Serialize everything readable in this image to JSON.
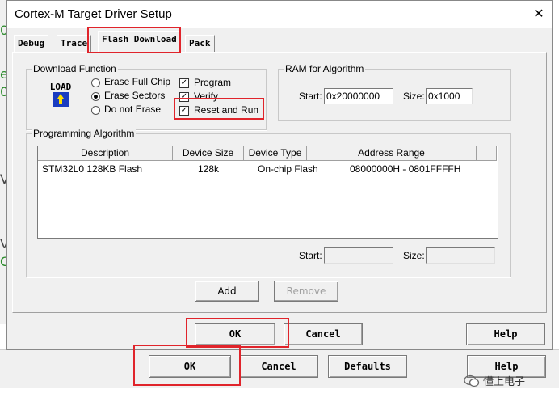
{
  "background_window": {
    "left_glyphs": [
      "0",
      "e",
      "0",
      "V",
      "V",
      "C"
    ],
    "buttons": {
      "ok": "OK",
      "cancel": "Cancel",
      "defaults": "Defaults",
      "help": "Help"
    }
  },
  "dialog": {
    "title": "Cortex-M Target Driver Setup",
    "close_icon": "close-icon",
    "tabs": [
      {
        "label": "Debug"
      },
      {
        "label": "Trace"
      },
      {
        "label": "Flash Download",
        "active": true
      },
      {
        "label": "Pack"
      }
    ],
    "download_function": {
      "title": "Download Function",
      "icon_text": "LOAD",
      "radios": [
        {
          "label": "Erase Full Chip",
          "selected": false
        },
        {
          "label": "Erase Sectors",
          "selected": true
        },
        {
          "label": "Do not Erase",
          "selected": false
        }
      ],
      "checkboxes": [
        {
          "label": "Program",
          "checked": true
        },
        {
          "label": "Verify",
          "checked": true
        },
        {
          "label": "Reset and Run",
          "checked": true
        }
      ]
    },
    "ram": {
      "title": "RAM for Algorithm",
      "start_label": "Start:",
      "start_value": "0x20000000",
      "size_label": "Size:",
      "size_value": "0x1000"
    },
    "programming_algorithm": {
      "title": "Programming Algorithm",
      "columns": [
        "Description",
        "Device Size",
        "Device Type",
        "Address Range"
      ],
      "rows": [
        [
          "STM32L0 128KB Flash",
          "128k",
          "On-chip Flash",
          "08000000H - 0801FFFFH"
        ]
      ],
      "start_label": "Start:",
      "start_value": "",
      "size_label": "Size:",
      "size_value": ""
    },
    "add_button": "Add",
    "remove_button": "Remove",
    "buttons": {
      "ok": "OK",
      "cancel": "Cancel",
      "help": "Help"
    }
  },
  "watermark": {
    "text": "懂上电子"
  },
  "colors": {
    "highlight": "#e0242b",
    "dialog_bg": "#f0f0f0"
  }
}
